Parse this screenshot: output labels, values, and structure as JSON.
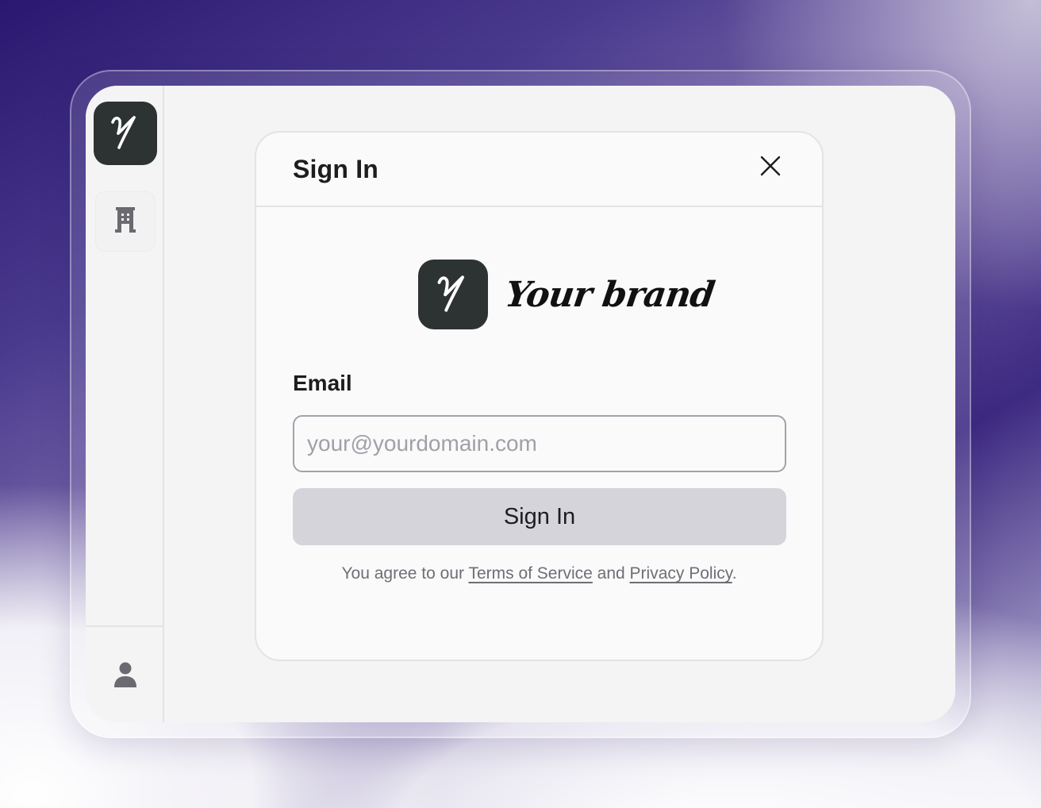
{
  "sidebar": {
    "logo_icon": "y-monogram-icon",
    "items": [
      {
        "icon": "building-icon"
      }
    ],
    "footer": {
      "icon": "user-icon"
    }
  },
  "modal": {
    "title": "Sign In",
    "close_icon": "close-icon",
    "brand": {
      "icon": "y-monogram-icon",
      "name": "Your brand"
    },
    "email": {
      "label": "Email",
      "value": "",
      "placeholder": "your@yourdomain.com"
    },
    "submit_label": "Sign In",
    "terms": {
      "prefix": "You agree to our ",
      "terms_link": "Terms of Service",
      "middle": " and ",
      "privacy_link": "Privacy Policy",
      "suffix": "."
    }
  },
  "colors": {
    "logo_bg": "#2d3232",
    "button_bg": "#d4d4da",
    "panel_bg": "#f4f4f4"
  }
}
